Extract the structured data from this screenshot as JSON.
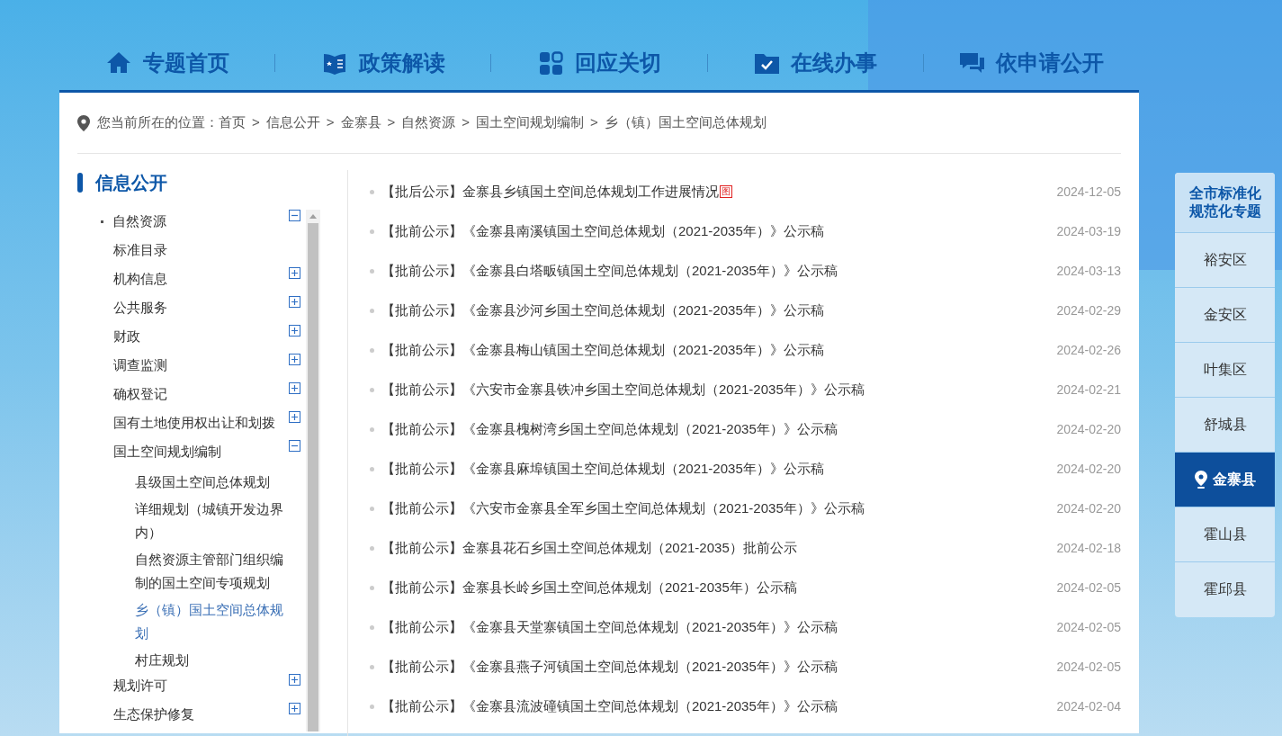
{
  "nav": [
    {
      "label": "专题首页"
    },
    {
      "label": "政策解读"
    },
    {
      "label": "回应关切"
    },
    {
      "label": "在线办事"
    },
    {
      "label": "依申请公开"
    }
  ],
  "breadcrumb": {
    "prefix": "您当前所在的位置：",
    "separator": ">",
    "items": [
      "首页",
      "信息公开",
      "金寨县",
      "自然资源",
      "国土空间规划编制",
      "乡（镇）国土空间总体规划"
    ]
  },
  "sidebar": {
    "title": "信息公开",
    "tree": [
      {
        "label": "自然资源",
        "kind": "folder",
        "expanded": true,
        "children": [
          {
            "label": "标准目录",
            "kind": "leaf"
          },
          {
            "label": "机构信息",
            "kind": "folder",
            "expanded": false
          },
          {
            "label": "公共服务",
            "kind": "folder",
            "expanded": false
          },
          {
            "label": "财政",
            "kind": "folder",
            "expanded": false
          },
          {
            "label": "调查监测",
            "kind": "folder",
            "expanded": false
          },
          {
            "label": "确权登记",
            "kind": "folder",
            "expanded": false
          },
          {
            "label": "国有土地使用权出让和划拨",
            "kind": "folder",
            "expanded": false
          },
          {
            "label": "国土空间规划编制",
            "kind": "folder",
            "expanded": true,
            "children": [
              {
                "label": "县级国土空间总体规划",
                "selected": false
              },
              {
                "label": "详细规划（城镇开发边界内）",
                "selected": false
              },
              {
                "label": "自然资源主管部门组织编制的国土空间专项规划",
                "selected": false
              },
              {
                "label": "乡（镇）国土空间总体规划",
                "selected": true
              },
              {
                "label": "村庄规划",
                "selected": false
              }
            ]
          },
          {
            "label": "规划许可",
            "kind": "folder",
            "expanded": false
          },
          {
            "label": "生态保护修复",
            "kind": "folder",
            "expanded": false
          }
        ]
      }
    ]
  },
  "articles": [
    {
      "title": "【批后公示】金寨县乡镇国土空间总体规划工作进展情况",
      "badge": "图",
      "date": "2024-12-05"
    },
    {
      "title": "【批前公示】《金寨县南溪镇国土空间总体规划（2021-2035年）》公示稿",
      "date": "2024-03-19"
    },
    {
      "title": "【批前公示】《金寨县白塔畈镇国土空间总体规划（2021-2035年）》公示稿",
      "date": "2024-03-13"
    },
    {
      "title": "【批前公示】《金寨县沙河乡国土空间总体规划（2021-2035年）》公示稿",
      "date": "2024-02-29"
    },
    {
      "title": "【批前公示】《金寨县梅山镇国土空间总体规划（2021-2035年）》公示稿",
      "date": "2024-02-26"
    },
    {
      "title": "【批前公示】《六安市金寨县铁冲乡国土空间总体规划（2021-2035年）》公示稿",
      "date": "2024-02-21"
    },
    {
      "title": "【批前公示】《金寨县槐树湾乡国土空间总体规划（2021-2035年）》公示稿",
      "date": "2024-02-20"
    },
    {
      "title": "【批前公示】《金寨县麻埠镇国土空间总体规划（2021-2035年）》公示稿",
      "date": "2024-02-20"
    },
    {
      "title": "【批前公示】《六安市金寨县全军乡国土空间总体规划（2021-2035年）》公示稿",
      "date": "2024-02-20"
    },
    {
      "title": "【批前公示】金寨县花石乡国土空间总体规划（2021-2035）批前公示",
      "date": "2024-02-18"
    },
    {
      "title": "【批前公示】金寨县长岭乡国土空间总体规划（2021-2035年）公示稿",
      "date": "2024-02-05"
    },
    {
      "title": "【批前公示】《金寨县天堂寨镇国土空间总体规划（2021-2035年）》公示稿",
      "date": "2024-02-05"
    },
    {
      "title": "【批前公示】《金寨县燕子河镇国土空间总体规划（2021-2035年）》公示稿",
      "date": "2024-02-05"
    },
    {
      "title": "【批前公示】《金寨县流波䃥镇国土空间总体规划（2021-2035年）》公示稿",
      "date": "2024-02-04"
    }
  ],
  "regions": {
    "title": "全市标准化规范化专题",
    "items": [
      {
        "label": "裕安区",
        "selected": false
      },
      {
        "label": "金安区",
        "selected": false
      },
      {
        "label": "叶集区",
        "selected": false
      },
      {
        "label": "舒城县",
        "selected": false
      },
      {
        "label": "金寨县",
        "selected": true
      },
      {
        "label": "霍山县",
        "selected": false
      },
      {
        "label": "霍邱县",
        "selected": false
      }
    ]
  }
}
